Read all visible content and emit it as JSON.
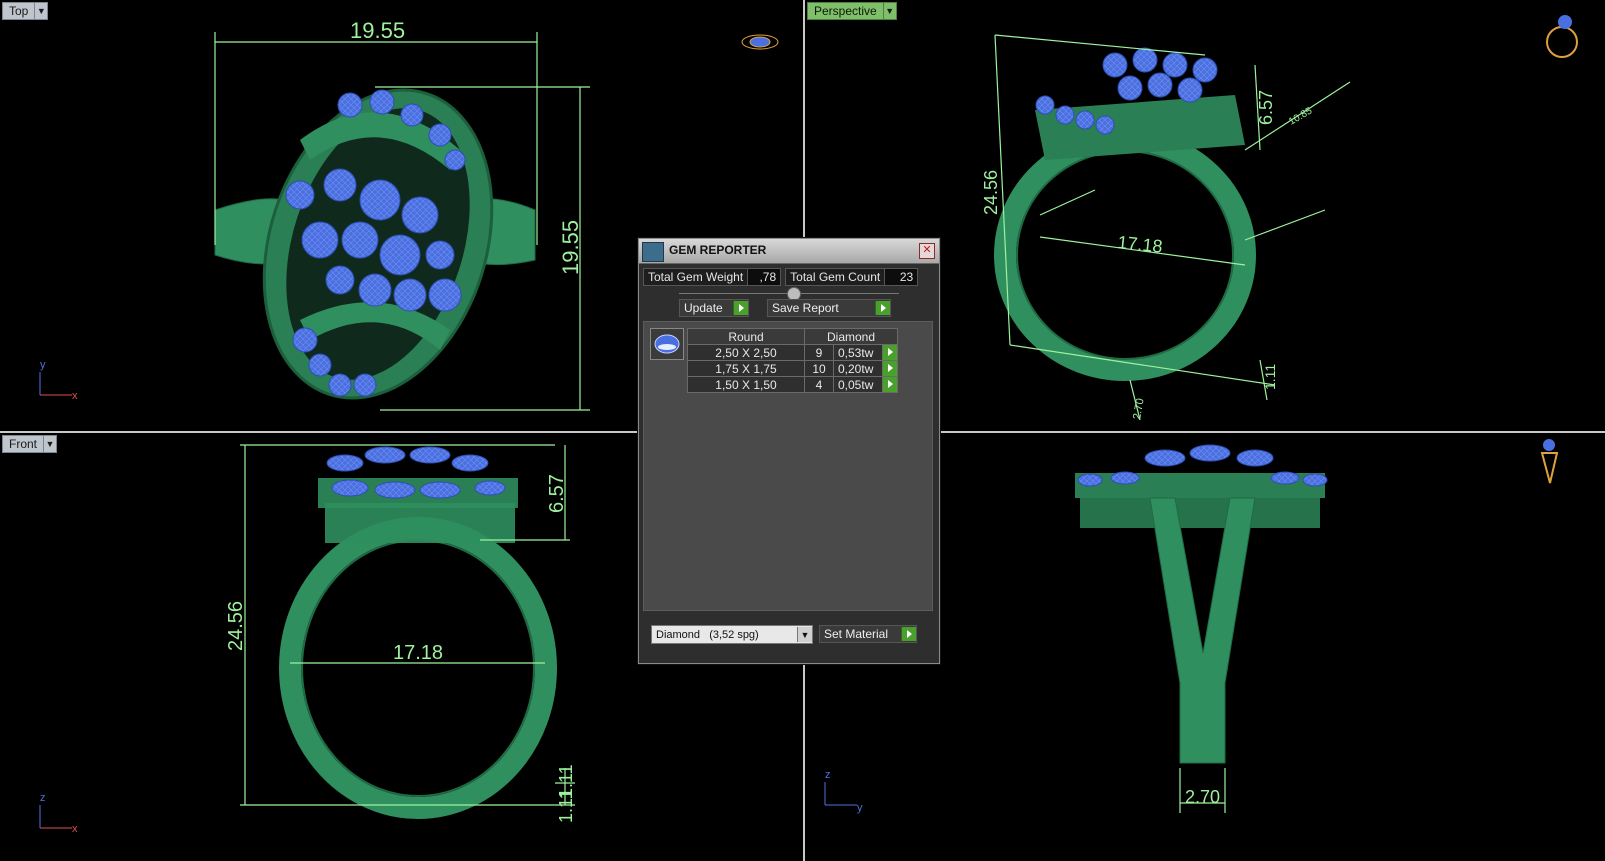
{
  "viewports": {
    "top": {
      "label": "Top",
      "dims": [
        "19.55",
        "19.55"
      ],
      "axes": [
        "y",
        "x"
      ]
    },
    "perspective": {
      "label": "Perspective",
      "dims": [
        "24.56",
        "6.57",
        "17.18",
        "1.11",
        "2.70",
        "10.85"
      ]
    },
    "front": {
      "label": "Front",
      "dims": [
        "24.56",
        "6.57",
        "17.18",
        "1.11",
        "1.11"
      ],
      "axes": [
        "z",
        "x"
      ]
    },
    "side": {
      "label": "",
      "dims": [
        "2.70"
      ],
      "axes": [
        "z",
        "y"
      ]
    }
  },
  "dialog": {
    "title": "GEM REPORTER",
    "total_weight_label": "Total Gem Weight",
    "total_weight_value": ",78",
    "total_count_label": "Total Gem Count",
    "total_count_value": "23",
    "update_label": "Update",
    "save_label": "Save Report",
    "table": {
      "headers": [
        "Round",
        "Diamond"
      ],
      "rows": [
        {
          "size": "2,50 X 2,50",
          "count": "9",
          "weight": "0,53tw"
        },
        {
          "size": "1,75 X 1,75",
          "count": "10",
          "weight": "0,20tw"
        },
        {
          "size": "1,50 X 1,50",
          "count": "4",
          "weight": "0,05tw"
        }
      ]
    },
    "material_value": "Diamond   (3,52 spg)",
    "set_material_label": "Set Material"
  },
  "colors": {
    "metal": "#2f8f5e",
    "gem": "#4a6fe0",
    "dimension": "#9ef29e",
    "viewport_bg": "#000000"
  }
}
